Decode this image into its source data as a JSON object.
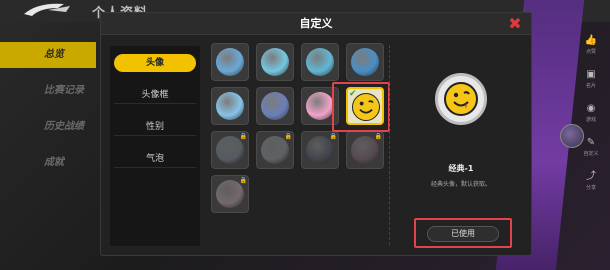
{
  "background": {
    "title": "个人资料",
    "nav": [
      {
        "label": "总览",
        "active": true
      },
      {
        "label": "比赛记录",
        "active": false
      },
      {
        "label": "历史战绩",
        "active": false
      },
      {
        "label": "成就",
        "active": false
      }
    ],
    "rail": [
      {
        "icon": "thumbs-up-icon",
        "glyph": "👍",
        "label": "点赞"
      },
      {
        "icon": "card-icon",
        "glyph": "▣",
        "label": "名片"
      },
      {
        "icon": "gamepad-icon",
        "glyph": "◉",
        "label": "游戏"
      },
      {
        "icon": "customize-icon",
        "glyph": "✎",
        "label": "自定义"
      },
      {
        "icon": "share-icon",
        "glyph": "⤴",
        "label": "分享"
      }
    ]
  },
  "modal": {
    "title": "自定义",
    "close_icon": "close-icon",
    "tabs": [
      {
        "label": "头像",
        "active": true
      },
      {
        "label": "头像框",
        "active": false
      },
      {
        "label": "性别",
        "active": false
      },
      {
        "label": "气泡",
        "active": false
      }
    ],
    "avatars": [
      {
        "name": "avatar-blue-creature-1",
        "color": "#6aa9d9",
        "locked": false,
        "selected": false
      },
      {
        "name": "avatar-blue-creature-2",
        "color": "#74c7e0",
        "locked": false,
        "selected": false
      },
      {
        "name": "avatar-blue-creature-3",
        "color": "#5fb8d6",
        "locked": false,
        "selected": false
      },
      {
        "name": "avatar-blue-creature-4",
        "color": "#4a8fc6",
        "locked": false,
        "selected": false
      },
      {
        "name": "avatar-ghost",
        "color": "#86c4e8",
        "locked": false,
        "selected": false
      },
      {
        "name": "avatar-wizard",
        "color": "#6b7fb8",
        "locked": false,
        "selected": false
      },
      {
        "name": "avatar-rainbow",
        "color": "#f1a3c9",
        "locked": false,
        "selected": false
      },
      {
        "name": "avatar-smiley-classic",
        "color": "#f5c518",
        "locked": false,
        "selected": true
      },
      {
        "name": "avatar-locked-1",
        "color": "#7a8fa0",
        "locked": true,
        "selected": false
      },
      {
        "name": "avatar-locked-2",
        "color": "#8898a8",
        "locked": true,
        "selected": false
      },
      {
        "name": "avatar-locked-3",
        "color": "#5a6a88",
        "locked": true,
        "selected": false
      },
      {
        "name": "avatar-locked-4",
        "color": "#9a6a8a",
        "locked": true,
        "selected": false
      },
      {
        "name": "avatar-locked-5",
        "color": "#c99aa8",
        "locked": true,
        "selected": false
      }
    ],
    "preview": {
      "name": "经典-1",
      "description": "经典头像，默认获取。",
      "button_label": "已使用"
    }
  },
  "colors": {
    "accent": "#f2c200",
    "highlight_red": "#e3434b",
    "close_red": "#e0383b"
  }
}
